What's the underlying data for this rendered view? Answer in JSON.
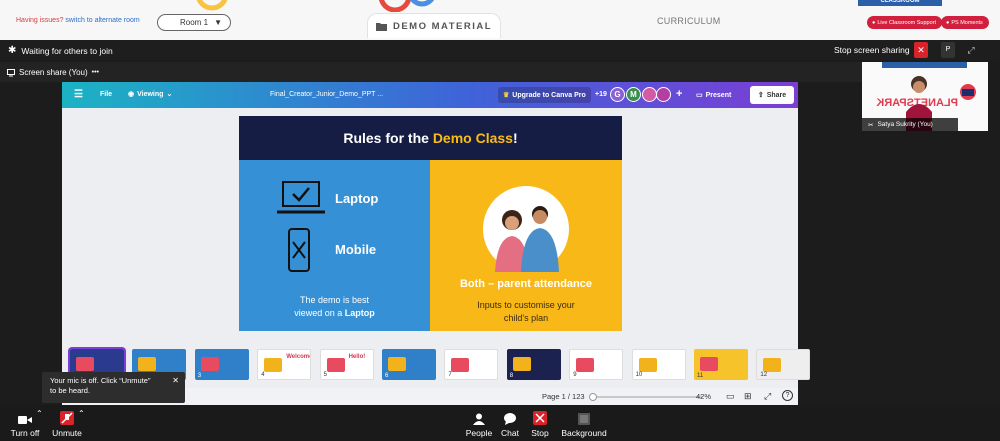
{
  "topbar": {
    "issues_question": "Having issues?",
    "issues_link": "switch to alternate room",
    "room_label": "Room 1",
    "demo_material": "DEMO MATERIAL",
    "curriculum": "CURRICULUM",
    "classroom": "CLASSROOM",
    "live_support": "Live Classroom Support",
    "ps_moments": "PS Moments"
  },
  "meeting": {
    "waiting": "Waiting for others to join",
    "stop_sharing": "Stop screen sharing",
    "p_label": "P",
    "screen_share": "Screen share (You)",
    "more": "•••"
  },
  "camera": {
    "participant_name": "Satya Sukrity (You)",
    "brand_text": "PLANETSPARK"
  },
  "canva": {
    "file": "File",
    "viewing": "Viewing",
    "doc_title": "Final_Creator_Junior_Demo_PPT ...",
    "upgrade": "Upgrade to Canva Pro",
    "collab_count": "+19",
    "avatar_g": "G",
    "avatar_m": "M",
    "present": "Present",
    "share": "Share"
  },
  "slide": {
    "title_a": "Rules for the ",
    "title_b": "Demo Class",
    "title_c": "!",
    "laptop": "Laptop",
    "mobile": "Mobile",
    "best_line1": "The demo is best",
    "best_line2a": "viewed on a ",
    "best_line2b": "Laptop",
    "both": "Both – parent attendance",
    "inputs_line1": "Inputs to customise your",
    "inputs_line2": "child's plan"
  },
  "thumbnails": [
    {
      "n": "",
      "bg": "#2a3a8f"
    },
    {
      "n": "",
      "bg": "#2f80c9"
    },
    {
      "n": "3",
      "bg": "#2f80c9"
    },
    {
      "n": "4",
      "bg": "#ffffff",
      "title": "Welcome!"
    },
    {
      "n": "5",
      "bg": "#ffffff",
      "title": "Hello!"
    },
    {
      "n": "6",
      "bg": "#2f80c9"
    },
    {
      "n": "7",
      "bg": "#ffffff"
    },
    {
      "n": "8",
      "bg": "#1c2250"
    },
    {
      "n": "9",
      "bg": "#ffffff"
    },
    {
      "n": "10",
      "bg": "#ffffff"
    },
    {
      "n": "11",
      "bg": "#f6c32b"
    },
    {
      "n": "12",
      "bg": "#eeeeee"
    }
  ],
  "pagebar": {
    "page": "Page 1 / 123",
    "zoom": "42%",
    "progress": 0.01
  },
  "toast": {
    "line1": "Your mic is off. Click “Unmute”",
    "line2": "to be heard.",
    "close": "✕"
  },
  "toolbar": {
    "turn_off": "Turn off",
    "unmute": "Unmute",
    "people": "People",
    "chat": "Chat",
    "stop": "Stop",
    "background": "Background"
  },
  "colors": {
    "accent_red": "#d1203e",
    "canva_grad_start": "#1bb3c4",
    "canva_grad_end": "#7b3ed6",
    "slide_blue": "#3590d6",
    "slide_yellow": "#f8b918",
    "slide_navy": "#161d45"
  }
}
